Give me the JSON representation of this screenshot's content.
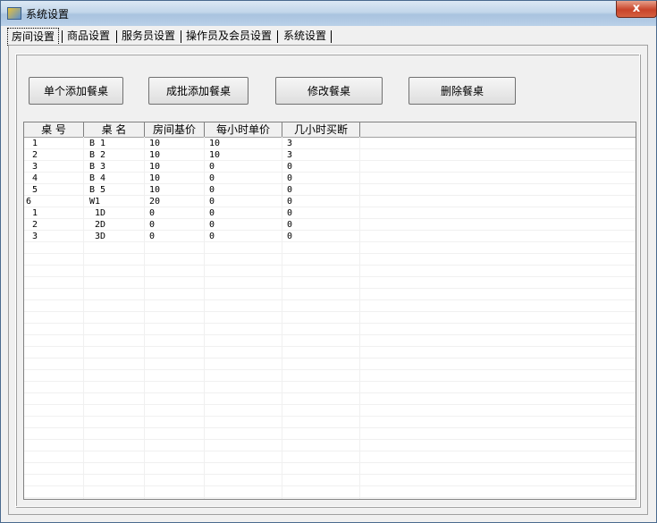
{
  "window": {
    "title": "系统设置",
    "close_label": "x"
  },
  "tabs": [
    {
      "label": "房间设置",
      "active": true
    },
    {
      "label": "商品设置"
    },
    {
      "label": "服务员设置"
    },
    {
      "label": "操作员及会员设置"
    },
    {
      "label": "系统设置"
    }
  ],
  "toolbar": {
    "add_single": "单个添加餐桌",
    "add_batch": "成批添加餐桌",
    "edit": "修改餐桌",
    "delete": "删除餐桌"
  },
  "table": {
    "columns": [
      "桌  号",
      "桌  名",
      "房间基价",
      "每小时单价",
      "几小时买断"
    ],
    "rows": [
      [
        "1",
        "B 1",
        "10",
        "10",
        "3"
      ],
      [
        "2",
        "B 2",
        "10",
        "10",
        "3"
      ],
      [
        "3",
        "B 3",
        "10",
        "0",
        "0"
      ],
      [
        "4",
        "B 4",
        "10",
        "0",
        "0"
      ],
      [
        "5",
        "B 5",
        "10",
        "0",
        "0"
      ],
      [
        "6",
        "W1",
        "20",
        "0",
        "0"
      ],
      [
        "1",
        "1D",
        "0",
        "0",
        "0"
      ],
      [
        "2",
        "2D",
        "0",
        "0",
        "0"
      ],
      [
        "3",
        "3D",
        "0",
        "0",
        "0"
      ]
    ]
  }
}
